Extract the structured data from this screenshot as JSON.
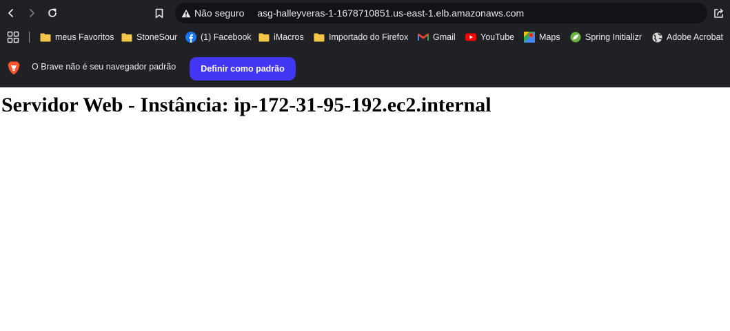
{
  "toolbar": {
    "security_label": "Não seguro",
    "url": "asg-halleyveras-1-1678710851.us-east-1.elb.amazonaws.com"
  },
  "bookmarks": [
    {
      "label": "meus Favoritos",
      "icon": "folder-icon"
    },
    {
      "label": "StoneSour",
      "icon": "folder-icon"
    },
    {
      "label": "(1) Facebook",
      "icon": "facebook-icon"
    },
    {
      "label": "iMacros",
      "icon": "folder-icon"
    },
    {
      "label": "Importado do Firefox",
      "icon": "folder-icon"
    },
    {
      "label": "Gmail",
      "icon": "gmail-icon"
    },
    {
      "label": "YouTube",
      "icon": "youtube-icon"
    },
    {
      "label": "Maps",
      "icon": "maps-icon"
    },
    {
      "label": "Spring Initializr",
      "icon": "spring-icon"
    },
    {
      "label": "Adobe Acrobat",
      "icon": "globe-icon"
    }
  ],
  "infobar": {
    "message": "O Brave não é seu navegador padrão",
    "button_label": "Definir como padrão"
  },
  "page": {
    "heading": "Servidor Web - Instância: ip-172-31-95-192.ec2.internal"
  },
  "colors": {
    "chrome_bg": "#202124",
    "omnibox_bg": "#121316",
    "accent_button": "#4436f5",
    "folder": "#f5c84c"
  }
}
